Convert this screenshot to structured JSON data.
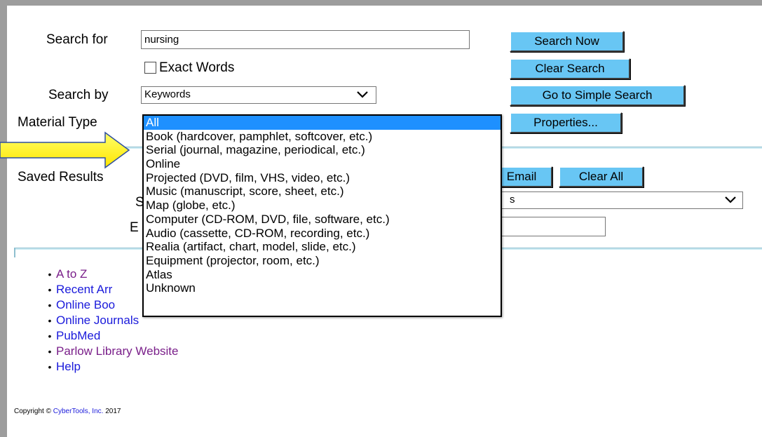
{
  "search": {
    "search_for_label": "Search for",
    "search_for_value": "nursing",
    "exact_words_label": "Exact Words",
    "search_by_label": "Search by",
    "search_by_value": "Keywords",
    "material_type_label": "Material Type"
  },
  "buttons": {
    "search_now": "Search Now",
    "clear_search": "Clear Search",
    "simple_search": "Go to Simple Search",
    "properties": "Properties...",
    "email": "Email",
    "clear_all": "Clear All"
  },
  "saved": {
    "label": "Saved Results",
    "row2_label_fragment": "S",
    "row2_value_fragment": "s",
    "row3_label_fragment": "E"
  },
  "dropdown": {
    "options": [
      "All",
      "Book (hardcover, pamphlet, softcover, etc.)",
      "Serial (journal, magazine, periodical, etc.)",
      "Online",
      "Projected (DVD, film, VHS, video, etc.)",
      "Music (manuscript, score, sheet, etc.)",
      "Map (globe, etc.)",
      "Computer (CD-ROM, DVD, file, software, etc.)",
      "Audio (cassette, CD-ROM, recording, etc.)",
      "Realia (artifact, chart, model, slide, etc.)",
      "Equipment (projector, room, etc.)",
      "Atlas",
      "Unknown"
    ],
    "selected": "All"
  },
  "links": [
    {
      "text": "A to Z",
      "visited": true
    },
    {
      "text": "Recent Arr",
      "visited": false
    },
    {
      "text": "Online Boo",
      "visited": false
    },
    {
      "text": "Online Journals",
      "visited": false
    },
    {
      "text": "PubMed",
      "visited": false
    },
    {
      "text": "Parlow Library Website",
      "visited": true
    },
    {
      "text": "Help",
      "visited": false
    }
  ],
  "footer": {
    "copyright_prefix": "Copyright © ",
    "company": "CyberTools, Inc.",
    "year": " 2017"
  },
  "colors": {
    "button_bg": "#68c6f4",
    "link": "#1a1adb",
    "link_visited": "#7a1f8a",
    "selected_option": "#1e90ff",
    "arrow": "#ffff00"
  },
  "icons": {
    "pointer_arrow": "yellow-arrow-icon",
    "select_chevron": "chevron-down-icon"
  }
}
